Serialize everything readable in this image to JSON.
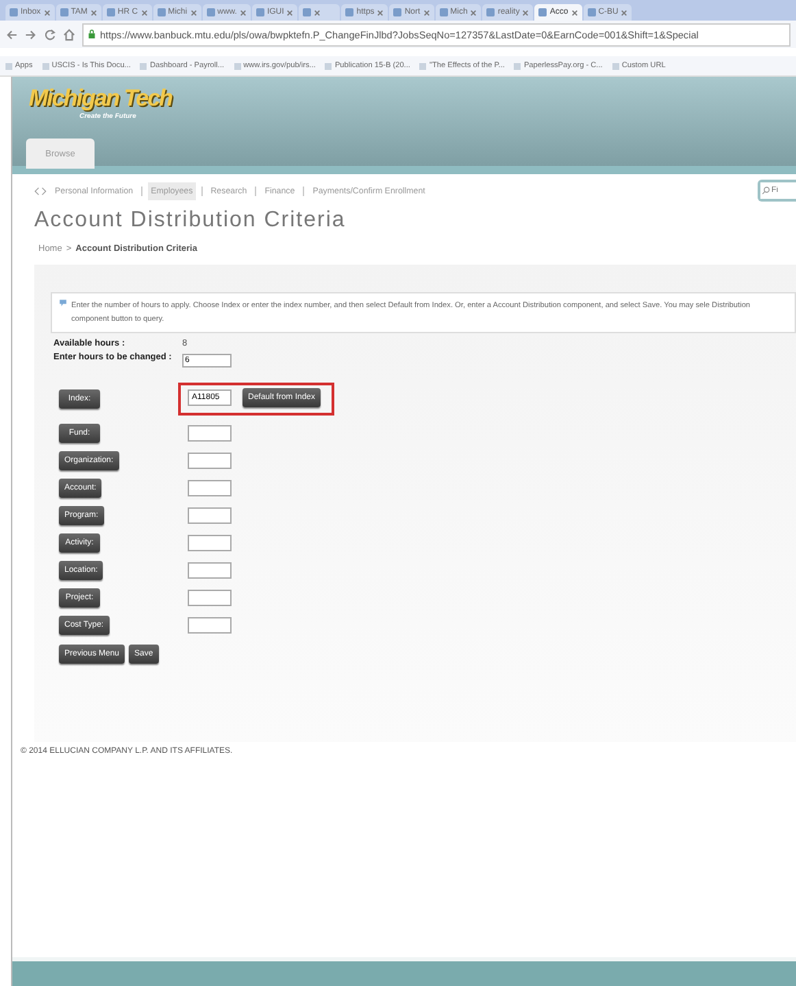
{
  "browser": {
    "tabs": [
      {
        "title": "Inbox",
        "selected": false
      },
      {
        "title": "TAM",
        "selected": false
      },
      {
        "title": "HR C",
        "selected": false
      },
      {
        "title": "Michi",
        "selected": false
      },
      {
        "title": "www.",
        "selected": false
      },
      {
        "title": "IGUI",
        "selected": false
      },
      {
        "selected": false
      },
      {
        "title": "https",
        "selected": false
      },
      {
        "title": "Nort",
        "selected": false
      },
      {
        "title": "Mich",
        "selected": false
      },
      {
        "title": "reality",
        "selected": false
      },
      {
        "title": "Acco",
        "selected": true
      },
      {
        "title": "C-BU",
        "selected": false
      }
    ],
    "url": "https://www.banbuck.mtu.edu/pls/owa/bwpktefn.P_ChangeFinJlbd?JobsSeqNo=127357&LastDate=0&EarnCode=001&Shift=1&Special",
    "bookmarks": [
      "Apps",
      "USCIS - Is This Docu...",
      "Dashboard - Payroll...",
      "www.irs.gov/pub/irs...",
      "Publication 15-B (20...",
      "\"The Effects of the P...",
      "PaperlessPay.org - C...",
      "Custom URL"
    ]
  },
  "header": {
    "logo": "Michigan Tech",
    "tagline": "Create the Future",
    "menu_button": "Browse"
  },
  "nav": {
    "items": [
      {
        "label": "Personal Information",
        "selected": false
      },
      {
        "label": "Employees",
        "selected": true
      },
      {
        "label": "Research",
        "selected": false
      },
      {
        "label": "Finance",
        "selected": false
      },
      {
        "label": "Payments/Confirm Enrollment",
        "selected": false
      }
    ],
    "search_placeholder": "Fi"
  },
  "page_title": "Account Distribution Criteria",
  "breadcrumb": {
    "home": "Home",
    "separator": ">",
    "current": "Account Distribution Criteria"
  },
  "info": "Enter the number of hours to apply. Choose Index or enter the index number, and then select Default from Index. Or, enter a Account Distribution component, and select Save. You may sele Distribution component button to query.",
  "available_hours": {
    "label": "Available hours :",
    "value": "8"
  },
  "hours_to_change": {
    "label": "Enter hours to be changed :",
    "value": "6"
  },
  "index": {
    "label": "Index:",
    "value": "A11805",
    "button": "Default from Index"
  },
  "fields": [
    {
      "label": "Fund:"
    },
    {
      "label": "Organization:"
    },
    {
      "label": "Account:"
    },
    {
      "label": "Program:"
    },
    {
      "label": "Activity:"
    },
    {
      "label": "Location:"
    },
    {
      "label": "Project:"
    },
    {
      "label": "Cost Type:"
    }
  ],
  "actions": [
    "Previous Menu",
    "Save"
  ],
  "copyright": "© 2014 ELLUCIAN COMPANY L.P. AND ITS AFFILIATES."
}
